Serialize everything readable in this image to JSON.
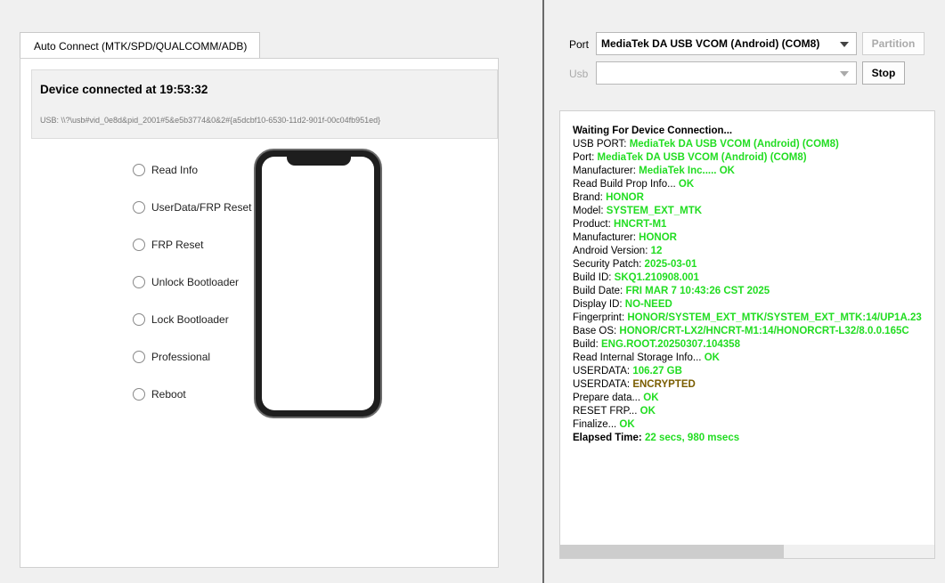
{
  "left": {
    "tab_label": "Auto Connect (MTK/SPD/QUALCOMM/ADB)",
    "status_title": "Device connected at 19:53:32",
    "usb_path": "USB: \\\\?\\usb#vid_0e8d&pid_2001#5&e5b3774&0&2#{a5dcbf10-6530-11d2-901f-00c04fb951ed}",
    "operations": [
      "Read Info",
      "UserData/FRP Reset",
      "FRP Reset",
      "Unlock Bootloader",
      "Lock Bootloader",
      "Professional",
      "Reboot"
    ]
  },
  "right": {
    "port_label": "Port",
    "port_value": "MediaTek DA USB VCOM (Android) (COM8)",
    "usb_label": "Usb",
    "usb_value": "",
    "partition_button": "Partition",
    "stop_button": "Stop",
    "log": [
      {
        "k": "Waiting For Device Connection...",
        "v": "",
        "bold": true
      },
      {
        "k": "USB PORT: ",
        "v": "MediaTek DA USB VCOM (Android) (COM8)"
      },
      {
        "k": "Port: ",
        "v": "MediaTek DA USB VCOM (Android) (COM8)"
      },
      {
        "k": "Manufacturer: ",
        "v": "MediaTek Inc..... OK"
      },
      {
        "k": "Read Build Prop Info... ",
        "v": "OK"
      },
      {
        "k": " Brand: ",
        "v": "HONOR"
      },
      {
        "k": " Model: ",
        "v": "SYSTEM_EXT_MTK"
      },
      {
        "k": " Product: ",
        "v": "HNCRT-M1"
      },
      {
        "k": " Manufacturer: ",
        "v": "HONOR"
      },
      {
        "k": " Android Version: ",
        "v": "12"
      },
      {
        "k": " Security Patch: ",
        "v": "2025-03-01"
      },
      {
        "k": " Build ID: ",
        "v": "SKQ1.210908.001"
      },
      {
        "k": " Build Date: ",
        "v": "FRI MAR  7 10:43:26 CST 2025"
      },
      {
        "k": " Display ID: ",
        "v": "NO-NEED"
      },
      {
        "k": " Fingerprint: ",
        "v": "HONOR/SYSTEM_EXT_MTK/SYSTEM_EXT_MTK:14/UP1A.23"
      },
      {
        "k": " Base OS: ",
        "v": "HONOR/CRT-LX2/HNCRT-M1:14/HONORCRT-L32/8.0.0.165C"
      },
      {
        "k": " Build: ",
        "v": "ENG.ROOT.20250307.104358"
      },
      {
        "k": "Read Internal Storage Info... ",
        "v": "OK"
      },
      {
        "k": "USERDATA: ",
        "v": "106.27 GB"
      },
      {
        "k": "USERDATA: ",
        "v": "ENCRYPTED",
        "warn": true
      },
      {
        "k": "Prepare data... ",
        "v": "OK"
      },
      {
        "k": "RESET FRP... ",
        "v": "OK"
      },
      {
        "k": "Finalize... ",
        "v": "OK"
      },
      {
        "k": "Elapsed Time: ",
        "v": "22 secs, 980 msecs",
        "bold": true
      }
    ]
  }
}
